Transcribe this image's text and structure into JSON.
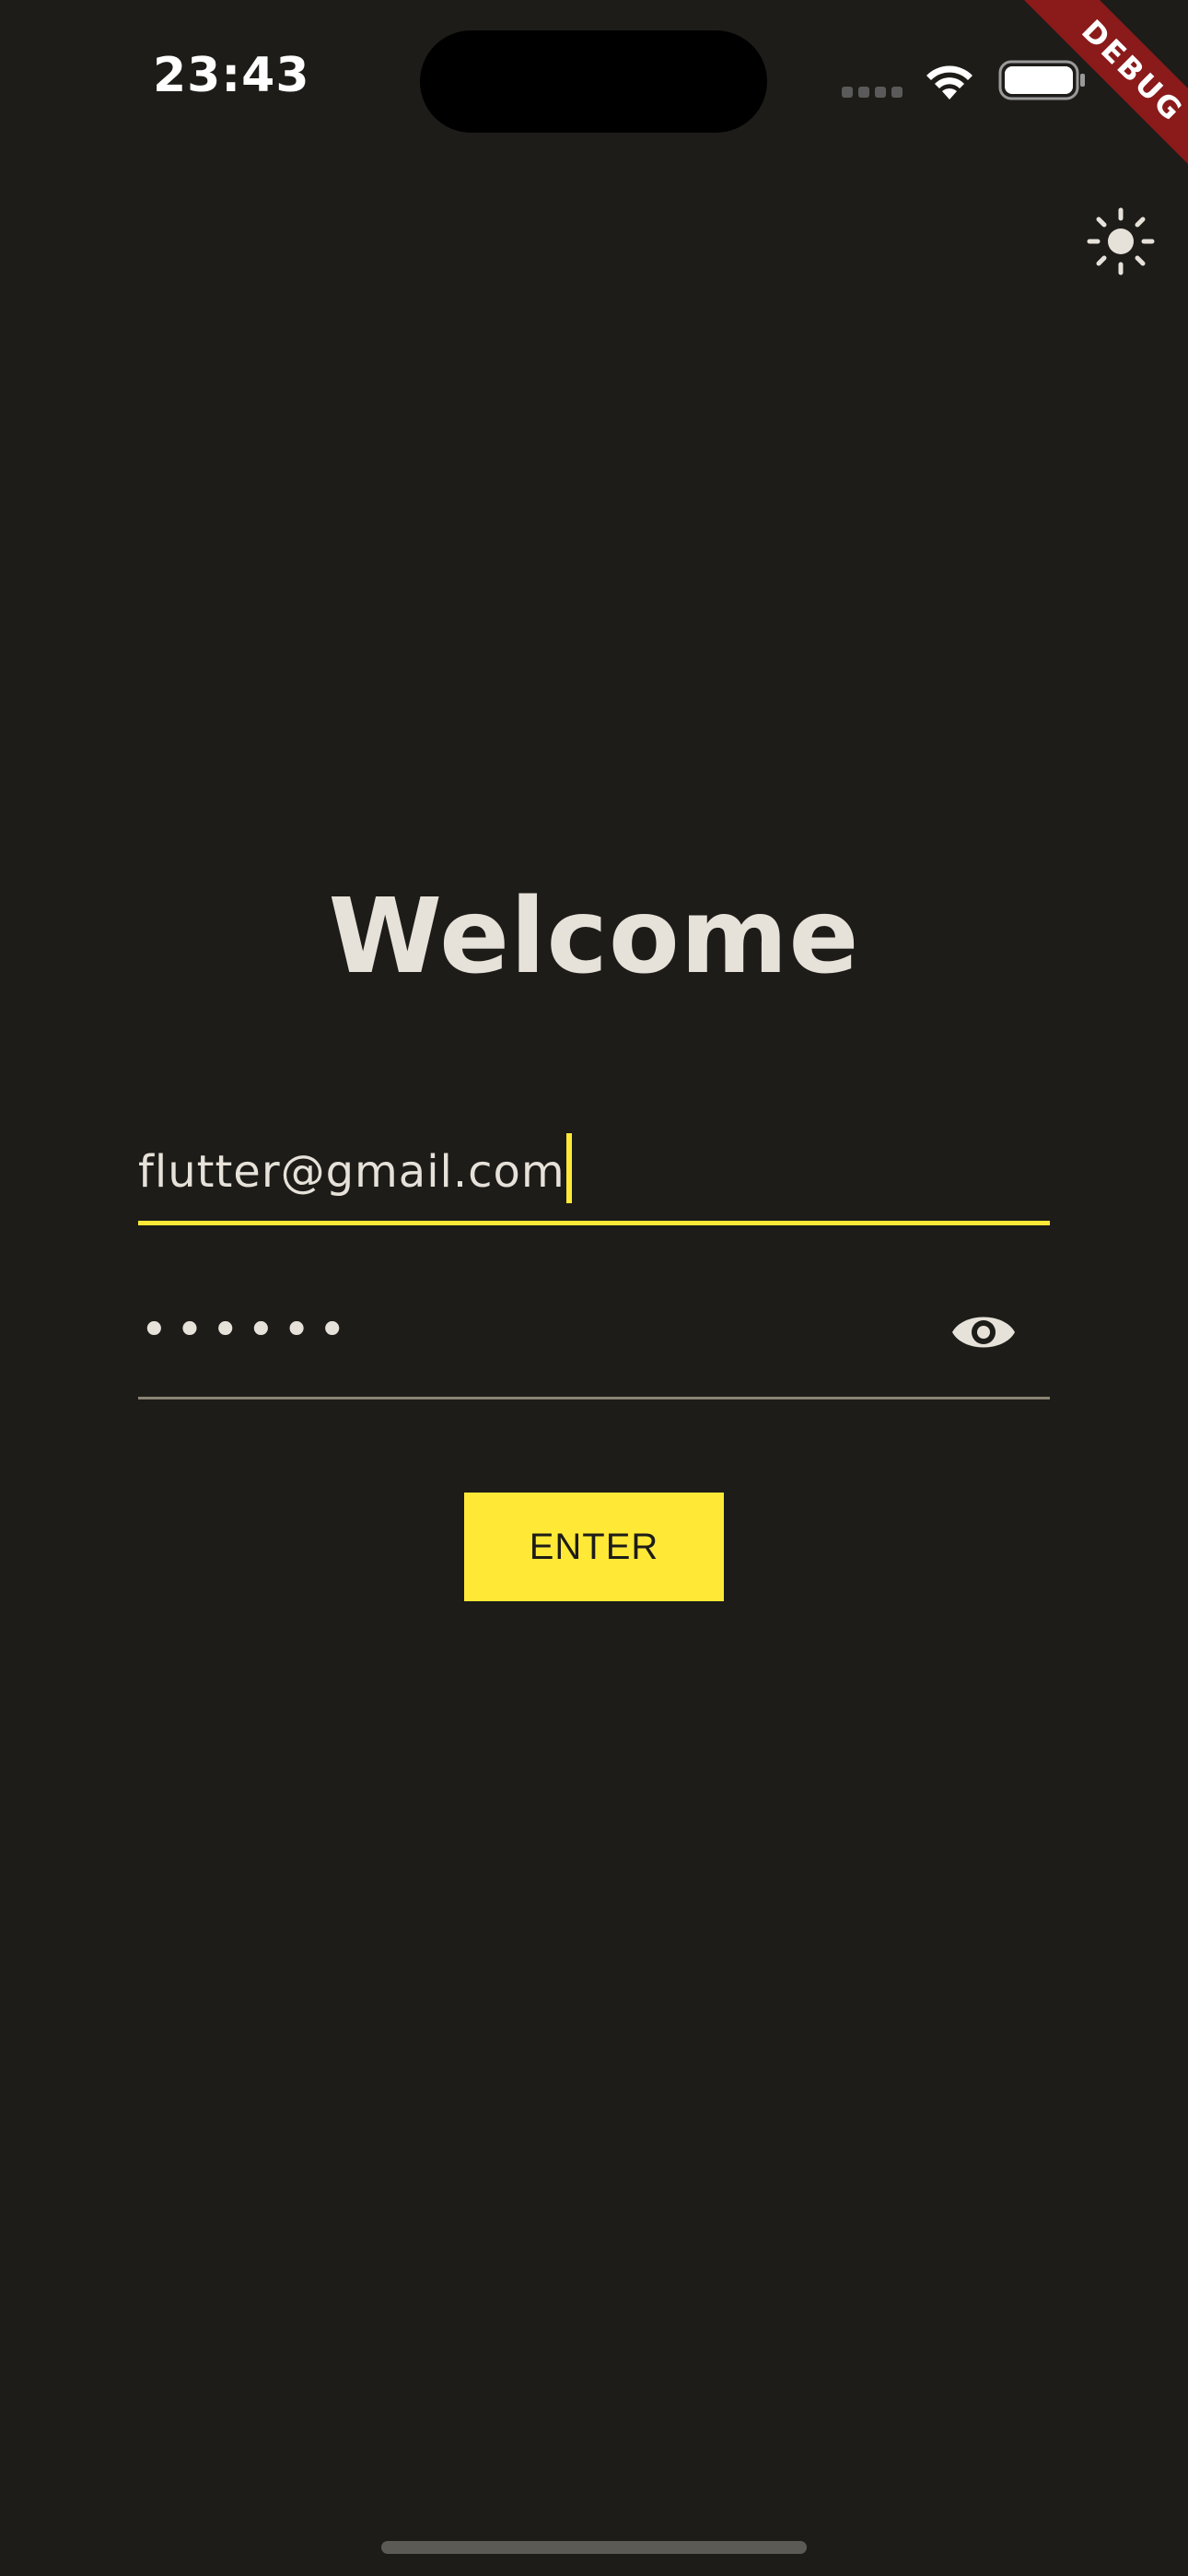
{
  "status_bar": {
    "time": "23:43",
    "icons": [
      "cellular-signal-icon",
      "wifi-icon",
      "battery-icon"
    ]
  },
  "debug_banner": {
    "label": "DEBUG",
    "color": "#8b1a1a"
  },
  "theme_toggle": {
    "icon": "sun-icon"
  },
  "login": {
    "title": "Welcome",
    "email": {
      "value": "flutter@gmail.com",
      "focused": true
    },
    "password": {
      "value": "••••••",
      "visibility_icon": "eye-icon"
    },
    "enter_button": {
      "label": "ENTER"
    }
  },
  "colors": {
    "background": "#1d1c18",
    "text": "#e6e1d9",
    "accent": "#ffe936",
    "underline_inactive": "#8a8474"
  }
}
